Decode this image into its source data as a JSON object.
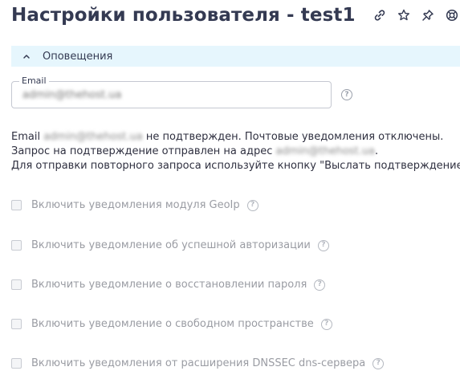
{
  "header": {
    "title": "Настройки пользователя - test1",
    "icons": [
      "link-icon",
      "star-icon",
      "pin-icon",
      "help-ring-icon"
    ]
  },
  "section": {
    "title": "Оповещения",
    "expanded": true
  },
  "email": {
    "label": "Email",
    "value": "admin@thehost.ua",
    "help": "?"
  },
  "notice": {
    "line1_prefix": "Email",
    "line1_email": "admin@thehost.ua",
    "line1_suffix": "не подтвержден. Почтовые уведомления отключены.",
    "line2_prefix": "Запрос на подтверждение отправлен на адрес",
    "line2_email": "admin@thehost.ua",
    "line2_suffix": ".",
    "line3": "Для отправки повторного запроса используйте кнопку \"Выслать подтверждение\""
  },
  "checkboxes": [
    {
      "label": "Включить уведомления модуля GeoIp",
      "checked": false,
      "disabled": true
    },
    {
      "label": "Включить уведомление об успешной авторизации",
      "checked": false,
      "disabled": true
    },
    {
      "label": "Включить уведомление о восстановлении пароля",
      "checked": false,
      "disabled": true
    },
    {
      "label": "Включить уведомление о свободном пространстве",
      "checked": false,
      "disabled": true
    },
    {
      "label": "Включить уведомления от расширения DNSSEC dns-сервера",
      "checked": false,
      "disabled": true
    }
  ],
  "help_glyph": "?",
  "colors": {
    "section_bg": "#e6f6fd",
    "title": "#343a52",
    "disabled_text": "#9a9ca3"
  }
}
